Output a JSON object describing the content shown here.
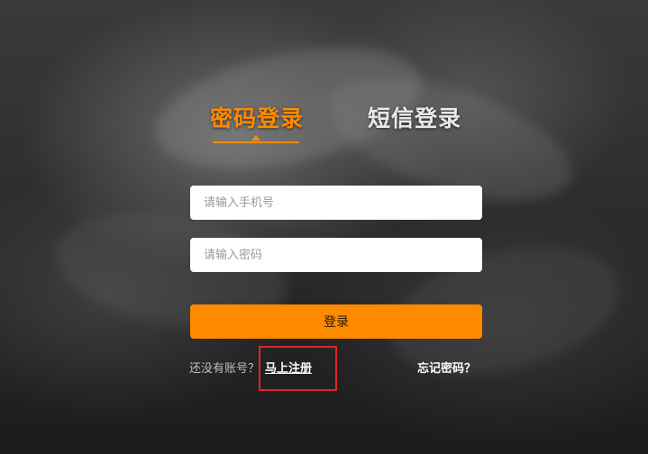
{
  "tabs": {
    "password_login": "密码登录",
    "sms_login": "短信登录"
  },
  "form": {
    "phone_placeholder": "请输入手机号",
    "password_placeholder": "请输入密码",
    "login_button": "登录"
  },
  "footer": {
    "no_account_text": "还没有账号？",
    "register_link": "马上注册",
    "forgot_password_link": "忘记密码？"
  },
  "colors": {
    "accent": "#ff8a00",
    "highlight_box": "#e0242b"
  }
}
